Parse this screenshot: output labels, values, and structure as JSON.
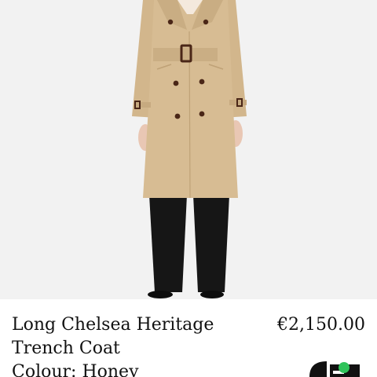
{
  "product": {
    "name": "Long Chelsea Heritage Trench Coat",
    "price": "€2,150.00",
    "colour_label": "Colour: Honey"
  },
  "colors": {
    "hero_background": "#f2f2f2",
    "coat": "#d6bb92",
    "trousers": "#161616"
  },
  "icons": {
    "badge": "brand-badge-icon",
    "status_dot": "green-dot-icon"
  }
}
